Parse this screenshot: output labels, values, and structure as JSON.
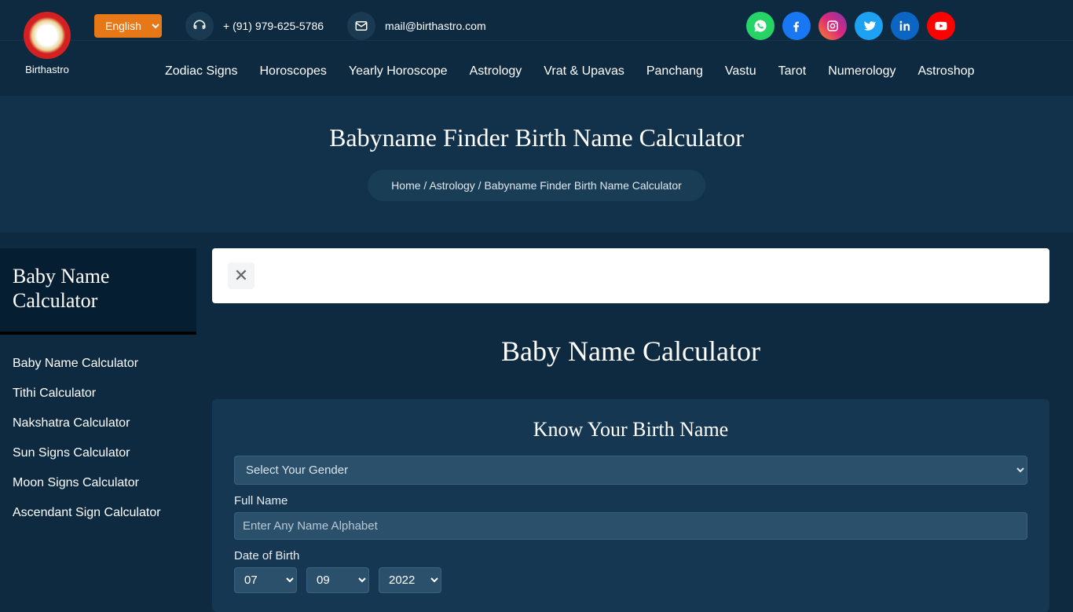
{
  "brand": "Birthastro",
  "lang_selected": "English",
  "contact": {
    "phone": "+ (91) 979-625-5786",
    "email": "mail@birthastro.com"
  },
  "nav": [
    "Zodiac Signs",
    "Horoscopes",
    "Yearly Horoscope",
    "Astrology",
    "Vrat & Upavas",
    "Panchang",
    "Vastu",
    "Tarot",
    "Numerology",
    "Astroshop"
  ],
  "hero": {
    "title": "Babyname Finder Birth Name Calculator",
    "crumbs": {
      "home": "Home",
      "sep": " / ",
      "mid": "Astrology",
      "last": "Babyname Finder Birth Name Calculator"
    }
  },
  "sidebar": {
    "heading": "Baby Name Calculator",
    "links": [
      "Baby Name Calculator",
      "Tithi Calculator",
      "Nakshatra Calculator",
      "Sun Signs Calculator",
      "Moon Signs Calculator",
      "Ascendant Sign Calculator"
    ]
  },
  "main": {
    "title": "Baby Name Calculator",
    "form": {
      "heading": "Know Your Birth Name",
      "gender_placeholder": "Select Your Gender",
      "fullname_label": "Full Name",
      "fullname_placeholder": "Enter Any Name Alphabet",
      "dob_label": "Date of Birth",
      "dob": {
        "day": "07",
        "month": "09",
        "year": "2022"
      }
    }
  }
}
